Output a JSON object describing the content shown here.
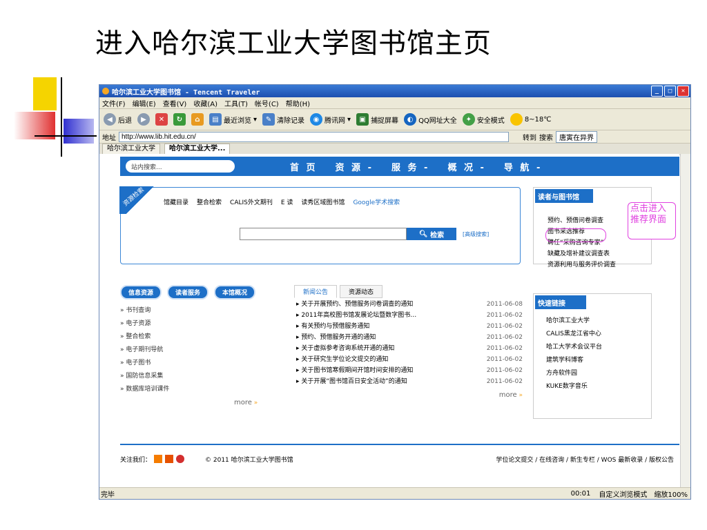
{
  "slide": {
    "title": "进入哈尔滨工业大学图书馆主页"
  },
  "window": {
    "title": "哈尔滨工业大学图书馆 - Tencent Traveler"
  },
  "menu": [
    "文件(F)",
    "编辑(E)",
    "查看(V)",
    "收藏(A)",
    "工具(T)",
    "帐号(C)",
    "帮助(H)"
  ],
  "toolbar": {
    "back": "后退",
    "recent": "最近浏览",
    "clear": "清除记录",
    "tencent": "腾讯网",
    "capture": "捕捉屏幕",
    "qq_sites": "QQ网址大全",
    "safe": "安全模式",
    "weather": "8~18℃"
  },
  "address": {
    "label": "地址",
    "url": "http://www.lib.hit.edu.cn/",
    "go": "转到",
    "search_label": "搜索",
    "search_value": "唐寅在异界"
  },
  "tabs": [
    "哈尔滨工业大学",
    "哈尔滨工业大学..."
  ],
  "site": {
    "search_placeholder": "站内搜索...",
    "nav": [
      "首 页",
      "资 源 -",
      "服 务 -",
      "概 况 -",
      "导 航 -"
    ],
    "res_ribbon": "资源检索",
    "res_tabs": [
      "馆藏目录",
      "整合检索",
      "CALIS外文期刊",
      "E 读",
      "读秀区域图书馆",
      "Google学术搜索"
    ],
    "search_button": "检索",
    "advanced": "[高级搜索]",
    "reader_head": "读者与图书馆",
    "reader_links": [
      "预约、预借问卷调查",
      "图书采选推荐",
      "聘任“采购咨询专家”",
      "缺藏及增补建议调查表",
      "资源利用与服务评价调查"
    ],
    "callout": "点击进入推荐界面",
    "pills": [
      "信息资源",
      "读者服务",
      "本馆概况"
    ],
    "left_links": [
      "书刊查询",
      "电子资源",
      "整合检索",
      "电子期刊导航",
      "电子图书",
      "国防信息采集",
      "数据库培训课件"
    ],
    "news_tabs": [
      "新闻公告",
      "资源动态"
    ],
    "news": [
      {
        "t": "关于开展预约、预借服务问卷调查的通知",
        "d": "2011-06-08"
      },
      {
        "t": "2011年高校图书馆发展论坛暨数字图书…",
        "d": "2011-06-02"
      },
      {
        "t": "有关预约与预借服务通知",
        "d": "2011-06-02"
      },
      {
        "t": "预约、预借服务开通的通知",
        "d": "2011-06-02"
      },
      {
        "t": "关于虚拟参考咨询系统开通的通知",
        "d": "2011-06-02"
      },
      {
        "t": "关于研究生学位论文提交的通知",
        "d": "2011-06-02"
      },
      {
        "t": "关于图书馆寒假期间开馆时间安排的通知",
        "d": "2011-06-02"
      },
      {
        "t": "关于开展“图书馆百日安全活动”的通知",
        "d": "2011-06-02"
      }
    ],
    "more": "more",
    "quick_head": "快速链接",
    "quick_links": [
      "哈尔滨工业大学",
      "CALIS黑龙江省中心",
      "哈工大学术会议平台",
      "建筑学科博客",
      "方舟软件园",
      "KUKE数字音乐"
    ],
    "follow": "关注我们：",
    "copyright": "© 2011 哈尔滨工业大学图书馆",
    "footer_links": "学位论文提交 / 在线咨询 / 新生专栏 / WOS 最新收录 / 版权公告"
  },
  "status": {
    "left": "完毕",
    "time": "00:01",
    "mode": "自定义浏览模式",
    "zoom": "缩放100%"
  }
}
